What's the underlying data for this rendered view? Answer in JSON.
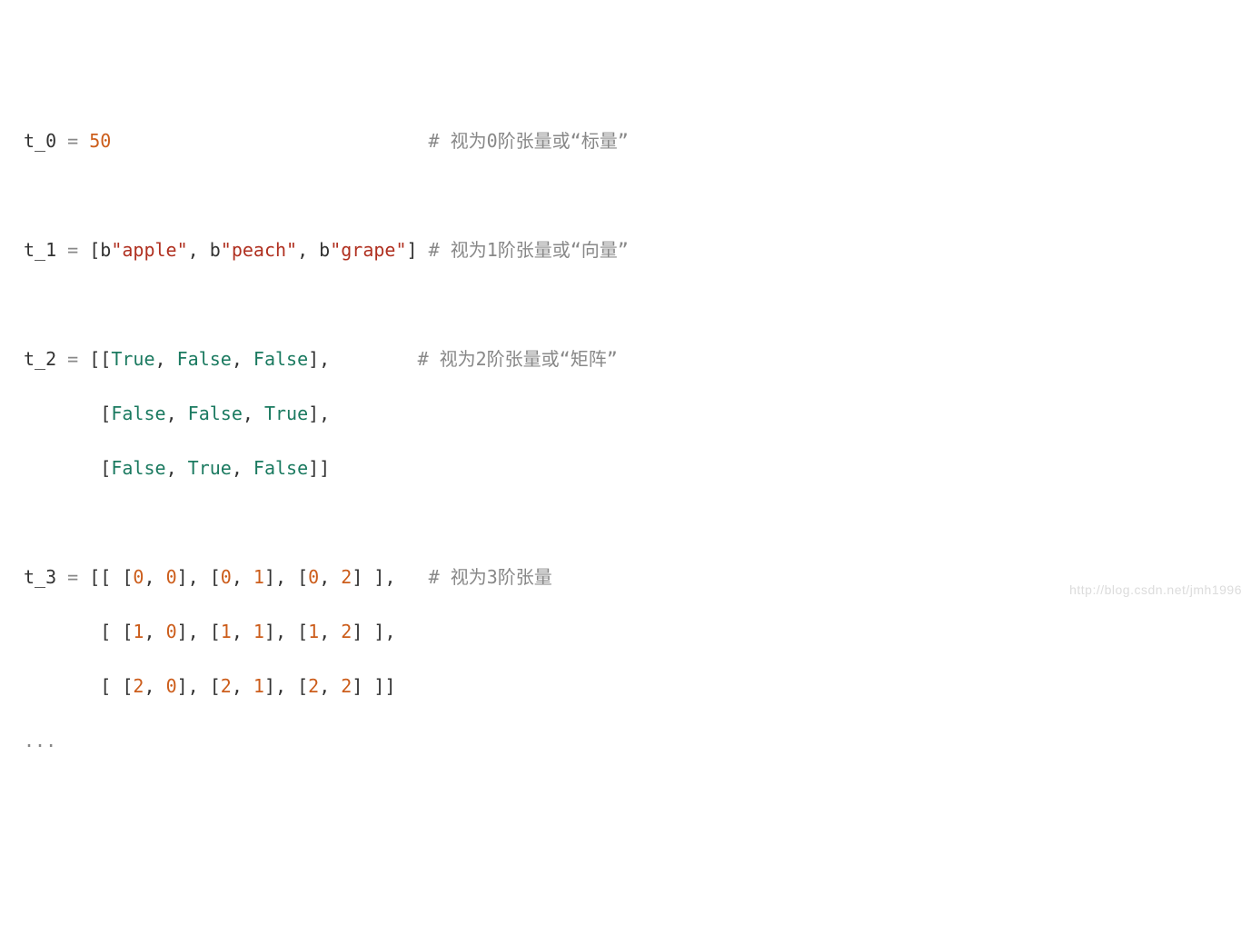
{
  "code": {
    "t0": {
      "var": "t_0",
      "eq": " = ",
      "val": "50",
      "gap": "                             ",
      "comment": "# 视为0阶张量或“标量”"
    },
    "t1": {
      "var": "t_1",
      "eq": " = ",
      "open": "[",
      "b": "b",
      "s1": "\"apple\"",
      "c1": ", ",
      "s2": "\"peach\"",
      "c2": ", ",
      "s3": "\"grape\"",
      "close": "]",
      "gap": " ",
      "comment": "# 视为1阶张量或“向量”"
    },
    "t2": {
      "var": "t_2",
      "eq": " = ",
      "r1": {
        "open": "[[",
        "a": "True",
        "c1": ", ",
        "b": "False",
        "c2": ", ",
        "c": "False",
        "close": "],",
        "gap": "        ",
        "comment": "# 视为2阶张量或“矩阵”"
      },
      "r2": {
        "indent": "       ",
        "open": "[",
        "a": "False",
        "c1": ", ",
        "b": "False",
        "c2": ", ",
        "c": "True",
        "close": "],"
      },
      "r3": {
        "indent": "       ",
        "open": "[",
        "a": "False",
        "c1": ", ",
        "b": "True",
        "c2": ", ",
        "c": "False",
        "close": "]]"
      }
    },
    "t3": {
      "var": "t_3",
      "eq": " = ",
      "r1": {
        "open": "[[ [",
        "a1": "0",
        "c1": ", ",
        "a2": "0",
        "m1": "], [",
        "b1": "0",
        "c2": ", ",
        "b2": "1",
        "m2": "], [",
        "d1": "0",
        "c3": ", ",
        "d2": "2",
        "close": "] ],",
        "gap": "   ",
        "comment": "# 视为3阶张量"
      },
      "r2": {
        "indent": "       ",
        "open": "[ [",
        "a1": "1",
        "c1": ", ",
        "a2": "0",
        "m1": "], [",
        "b1": "1",
        "c2": ", ",
        "b2": "1",
        "m2": "], [",
        "d1": "1",
        "c3": ", ",
        "d2": "2",
        "close": "] ],"
      },
      "r3": {
        "indent": "       ",
        "open": "[ [",
        "a1": "2",
        "c1": ", ",
        "a2": "0",
        "m1": "], [",
        "b1": "2",
        "c2": ", ",
        "b2": "1",
        "m2": "], [",
        "d1": "2",
        "c3": ", ",
        "d2": "2",
        "close": "] ]]"
      }
    },
    "ellipsis": "..."
  },
  "watermark": "http://blog.csdn.net/jmh1996"
}
